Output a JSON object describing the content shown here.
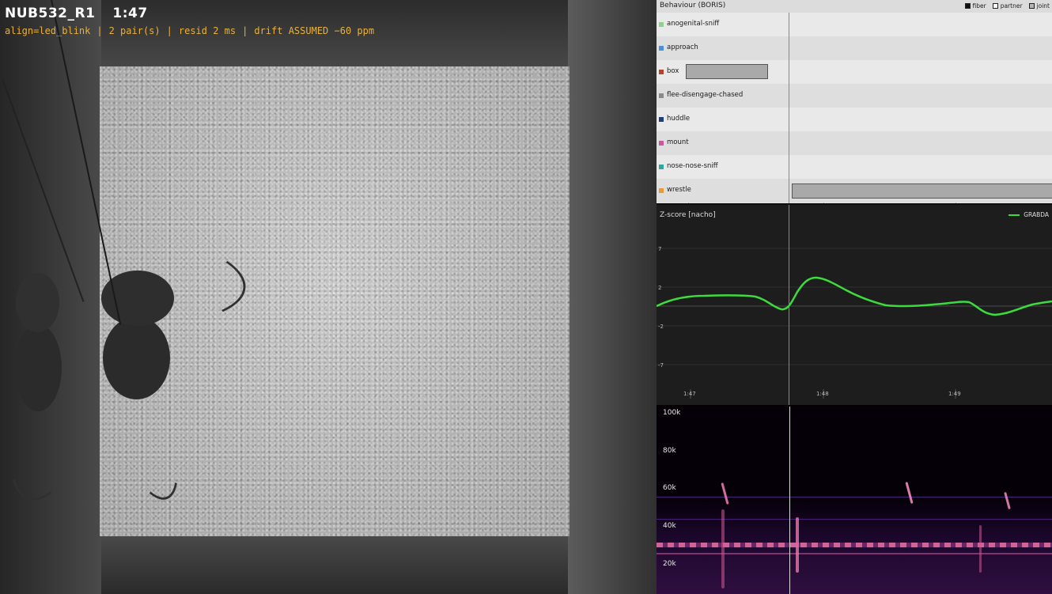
{
  "video": {
    "session_id": "NUB532_R1",
    "timestamp": "1:47",
    "info": [
      "align=led_blink",
      "2 pair(s)",
      "resid 2 ms",
      "drift ASSUMED −60 ppm"
    ]
  },
  "behaviour": {
    "title": "Behaviour (BORIS)",
    "legend": [
      {
        "label": "fiber",
        "color": "#111111"
      },
      {
        "label": "partner",
        "color": "#ffffff"
      },
      {
        "label": "joint",
        "color": "#b5b5b5"
      }
    ],
    "rows": [
      {
        "label": "anogenital-sniff",
        "color": "#8fd18f"
      },
      {
        "label": "approach",
        "color": "#4a90d9"
      },
      {
        "label": "box",
        "color": "#b0452a"
      },
      {
        "label": "flee-disengage-chased",
        "color": "#8a8a8a"
      },
      {
        "label": "huddle",
        "color": "#1f3d7a"
      },
      {
        "label": "mount",
        "color": "#c75a9a"
      },
      {
        "label": "nose-nose-sniff",
        "color": "#2fa6a0"
      },
      {
        "label": "wrestle",
        "color": "#e89a3a"
      }
    ]
  },
  "zscore": {
    "title": "Z-score  [nacho]",
    "series_name": "GRABDA",
    "series_color": "#3ddc3d",
    "y_ticks": [
      "7",
      "2",
      "-2",
      "-7"
    ],
    "x_ticks": [
      "1:47",
      "1:48",
      "1:49"
    ]
  },
  "spectrogram": {
    "y_ticks": [
      "100k",
      "80k",
      "60k",
      "40k",
      "20k"
    ]
  },
  "colors": {
    "accent_orange": "#e8692a",
    "hud_yellow": "#e8b23a"
  }
}
